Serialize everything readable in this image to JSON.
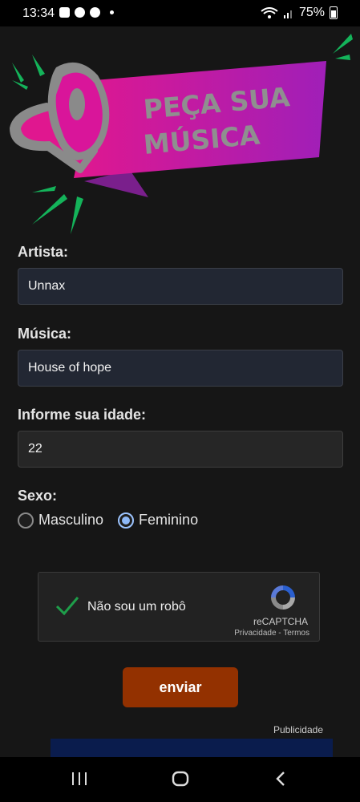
{
  "status_bar": {
    "time": "13:34",
    "battery": "75%"
  },
  "banner": {
    "line1": "PEÇA SUA",
    "line2": "MÚSICA"
  },
  "form": {
    "artist_label": "Artista:",
    "artist_value": "Unnax",
    "song_label": "Música:",
    "song_value": "House of hope",
    "age_label": "Informe sua idade:",
    "age_value": "22",
    "sex_label": "Sexo:",
    "sex_options": [
      "Masculino",
      "Feminino"
    ],
    "sex_selected": "Feminino"
  },
  "captcha": {
    "text": "Não sou um robô",
    "brand": "reCAPTCHA",
    "links": "Privacidade - Termos"
  },
  "submit_label": "enviar",
  "ad_label": "Publicidade",
  "colors": {
    "background": "#161616",
    "banner_magenta": "#d6189b",
    "banner_purple": "#9b1fb5",
    "accent_green": "#14b35a",
    "submit": "#933100",
    "ad_blue": "#0a1c4d"
  }
}
